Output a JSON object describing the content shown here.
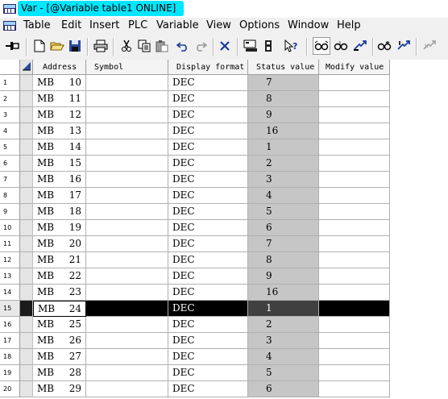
{
  "window": {
    "title": "Var - [@Variable table1  ONLINE]",
    "title_highlight_color": "#00e6ff"
  },
  "menu": {
    "items": [
      "Table",
      "Edit",
      "Insert",
      "PLC",
      "Variable",
      "View",
      "Options",
      "Window",
      "Help"
    ]
  },
  "toolbar": {
    "icons": [
      "pin-icon",
      "new-document-icon",
      "open-folder-icon",
      "save-icon",
      "print-icon",
      "cut-icon",
      "copy-icon",
      "paste-icon",
      "undo-icon",
      "redo-icon",
      "delete-icon",
      "monitor-plc-icon",
      "plc-icon",
      "help-cursor-icon",
      "monitor-glasses-icon",
      "monitor-once-icon",
      "modify-icon",
      "monitor-immediate-icon",
      "modify-immediate-icon",
      "disabled-modify-icon"
    ]
  },
  "table": {
    "headers": [
      "Address",
      "Symbol",
      "Display format",
      "Status value",
      "Modify value"
    ],
    "status_column_color": "#c6c6c6",
    "selected_row_index": 14,
    "rows": [
      {
        "num": "1",
        "addr_op": "MB",
        "addr_val": "10",
        "symbol": "",
        "format": "DEC",
        "status": "7",
        "modify": ""
      },
      {
        "num": "2",
        "addr_op": "MB",
        "addr_val": "11",
        "symbol": "",
        "format": "DEC",
        "status": "8",
        "modify": ""
      },
      {
        "num": "3",
        "addr_op": "MB",
        "addr_val": "12",
        "symbol": "",
        "format": "DEC",
        "status": "9",
        "modify": ""
      },
      {
        "num": "4",
        "addr_op": "MB",
        "addr_val": "13",
        "symbol": "",
        "format": "DEC",
        "status": "16",
        "modify": ""
      },
      {
        "num": "5",
        "addr_op": "MB",
        "addr_val": "14",
        "symbol": "",
        "format": "DEC",
        "status": "1",
        "modify": ""
      },
      {
        "num": "6",
        "addr_op": "MB",
        "addr_val": "15",
        "symbol": "",
        "format": "DEC",
        "status": "2",
        "modify": ""
      },
      {
        "num": "7",
        "addr_op": "MB",
        "addr_val": "16",
        "symbol": "",
        "format": "DEC",
        "status": "3",
        "modify": ""
      },
      {
        "num": "8",
        "addr_op": "MB",
        "addr_val": "17",
        "symbol": "",
        "format": "DEC",
        "status": "4",
        "modify": ""
      },
      {
        "num": "9",
        "addr_op": "MB",
        "addr_val": "18",
        "symbol": "",
        "format": "DEC",
        "status": "5",
        "modify": ""
      },
      {
        "num": "10",
        "addr_op": "MB",
        "addr_val": "19",
        "symbol": "",
        "format": "DEC",
        "status": "6",
        "modify": ""
      },
      {
        "num": "11",
        "addr_op": "MB",
        "addr_val": "20",
        "symbol": "",
        "format": "DEC",
        "status": "7",
        "modify": ""
      },
      {
        "num": "12",
        "addr_op": "MB",
        "addr_val": "21",
        "symbol": "",
        "format": "DEC",
        "status": "8",
        "modify": ""
      },
      {
        "num": "13",
        "addr_op": "MB",
        "addr_val": "22",
        "symbol": "",
        "format": "DEC",
        "status": "9",
        "modify": ""
      },
      {
        "num": "14",
        "addr_op": "MB",
        "addr_val": "23",
        "symbol": "",
        "format": "DEC",
        "status": "16",
        "modify": ""
      },
      {
        "num": "15",
        "addr_op": "MB",
        "addr_val": "24",
        "symbol": "",
        "format": "DEC",
        "status": "1",
        "modify": ""
      },
      {
        "num": "16",
        "addr_op": "MB",
        "addr_val": "25",
        "symbol": "",
        "format": "DEC",
        "status": "2",
        "modify": ""
      },
      {
        "num": "17",
        "addr_op": "MB",
        "addr_val": "26",
        "symbol": "",
        "format": "DEC",
        "status": "3",
        "modify": ""
      },
      {
        "num": "18",
        "addr_op": "MB",
        "addr_val": "27",
        "symbol": "",
        "format": "DEC",
        "status": "4",
        "modify": ""
      },
      {
        "num": "19",
        "addr_op": "MB",
        "addr_val": "28",
        "symbol": "",
        "format": "DEC",
        "status": "5",
        "modify": ""
      },
      {
        "num": "20",
        "addr_op": "MB",
        "addr_val": "29",
        "symbol": "",
        "format": "DEC",
        "status": "6",
        "modify": ""
      }
    ]
  }
}
